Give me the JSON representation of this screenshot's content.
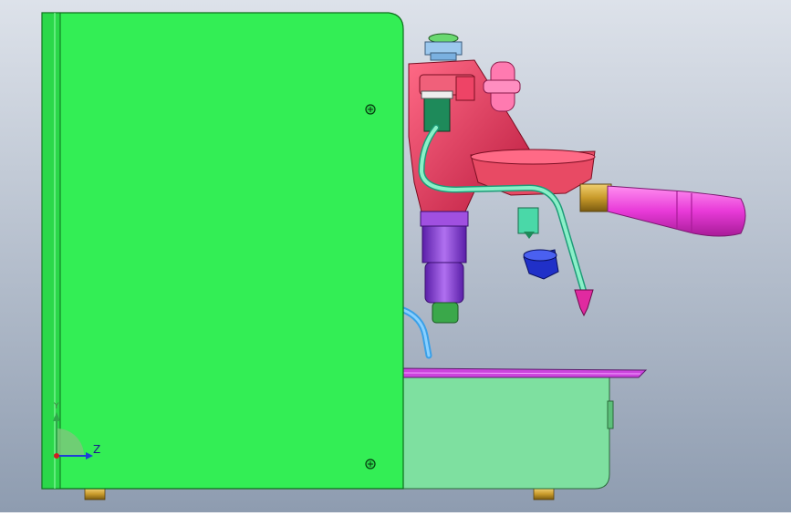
{
  "viewport": {
    "background_top": "#dde2ea",
    "background_bottom": "#8e9cb0"
  },
  "triad": {
    "z_label": "Z",
    "y_label": "Y",
    "z_color": "#1f3fd6",
    "y_color": "#2fa84a"
  },
  "colors": {
    "body_panel": "#33ee55",
    "body_edge": "#0b6e1a",
    "drip_tray": "#7ee0a0",
    "tray_grate": "#cc44dd",
    "group_head": "#e8365a",
    "handle": "#e83ad8",
    "portafilter": "#e84a64",
    "brass": "#c89a2a",
    "pump": "#8a3ad8",
    "steam_wand": "#8af0c8",
    "feet": "#c8a040",
    "blue_part": "#2030c8"
  }
}
